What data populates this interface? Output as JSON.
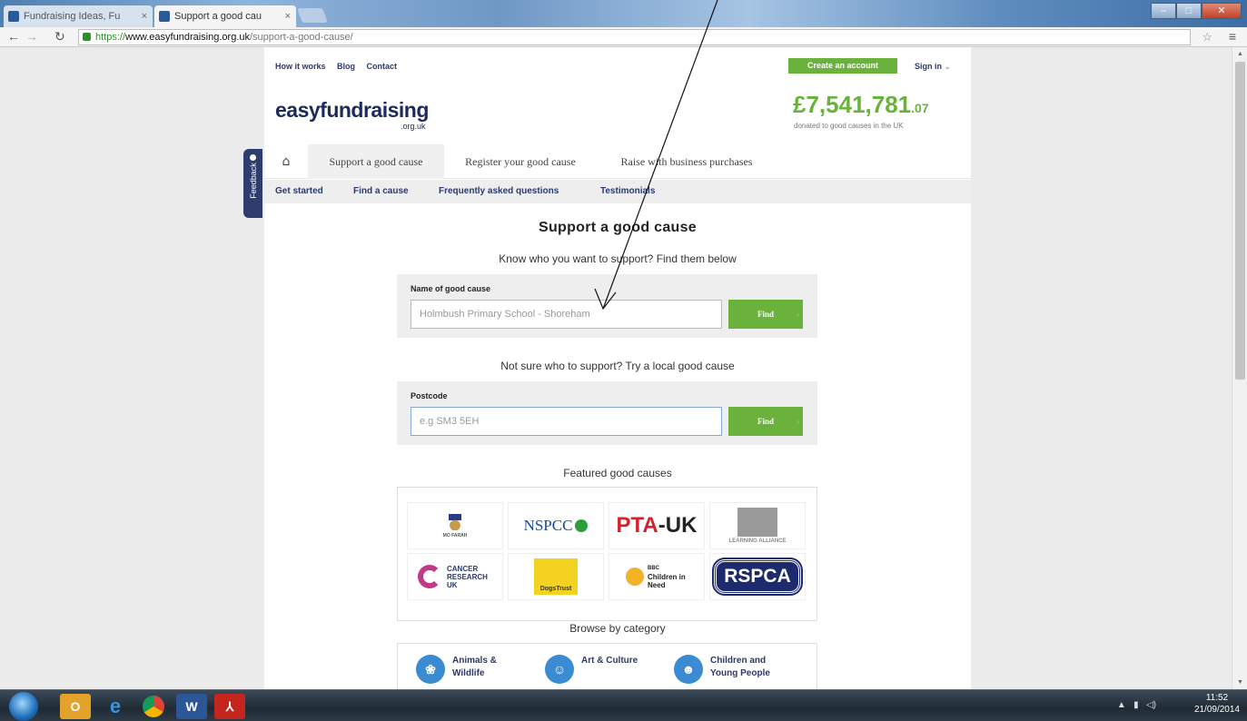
{
  "browser": {
    "tabs": [
      {
        "title": "Fundraising Ideas, Fu"
      },
      {
        "title": "Support a good cau"
      }
    ],
    "url_secure": "https://",
    "url_host": "www.easyfundraising.org.uk",
    "url_path": "/support-a-good-cause/"
  },
  "header": {
    "links": [
      "How it works",
      "Blog",
      "Contact"
    ],
    "create_account": "Create an account",
    "sign_in": "Sign in",
    "logo_main": "easy",
    "logo_green": "fundraising",
    "logo_sub": ".org.uk",
    "total_main": "£7,541,781",
    "total_pence": ".07",
    "total_caption": "donated to good causes in the UK"
  },
  "nav": {
    "items": [
      "Support a good cause",
      "Register your good cause",
      "Raise with business purchases"
    ],
    "sub": [
      "Get started",
      "Find a cause",
      "Frequently asked questions",
      "Testimonials"
    ]
  },
  "feedback": "Feedback",
  "main": {
    "title": "Support a good cause",
    "know_heading": "Know who you want to support? Find them below",
    "cause_label": "Name of good cause",
    "cause_value": "Holmbush Primary School - Shoreham",
    "find_label": "Find",
    "local_heading": "Not sure who to support? Try a local good cause",
    "postcode_label": "Postcode",
    "postcode_placeholder": "e.g SM3 5EH",
    "featured_heading": "Featured good causes",
    "browse_heading": "Browse by category"
  },
  "featured": {
    "mo_farah": "MO FARAH",
    "nspcc": "NSPCC",
    "pta_a": "PTA",
    "pta_b": "UK",
    "preschool": "LEARNING ALLIANCE",
    "cancer": "CANCER RESEARCH UK",
    "dogs": "DogsTrust",
    "cin_a": "BBC",
    "cin_b": "Children in Need",
    "rspca": "RSPCA"
  },
  "categories": [
    {
      "label": "Animals & Wildlife",
      "icon": "paw-icon"
    },
    {
      "label": "Art & Culture",
      "icon": "masks-icon"
    },
    {
      "label": "Children and Young People",
      "icon": "teddy-icon"
    }
  ],
  "taskbar": {
    "time": "11:52",
    "date": "21/09/2014"
  },
  "colors": {
    "brand_green": "#6ab23b",
    "brand_navy": "#2b3a6b"
  }
}
